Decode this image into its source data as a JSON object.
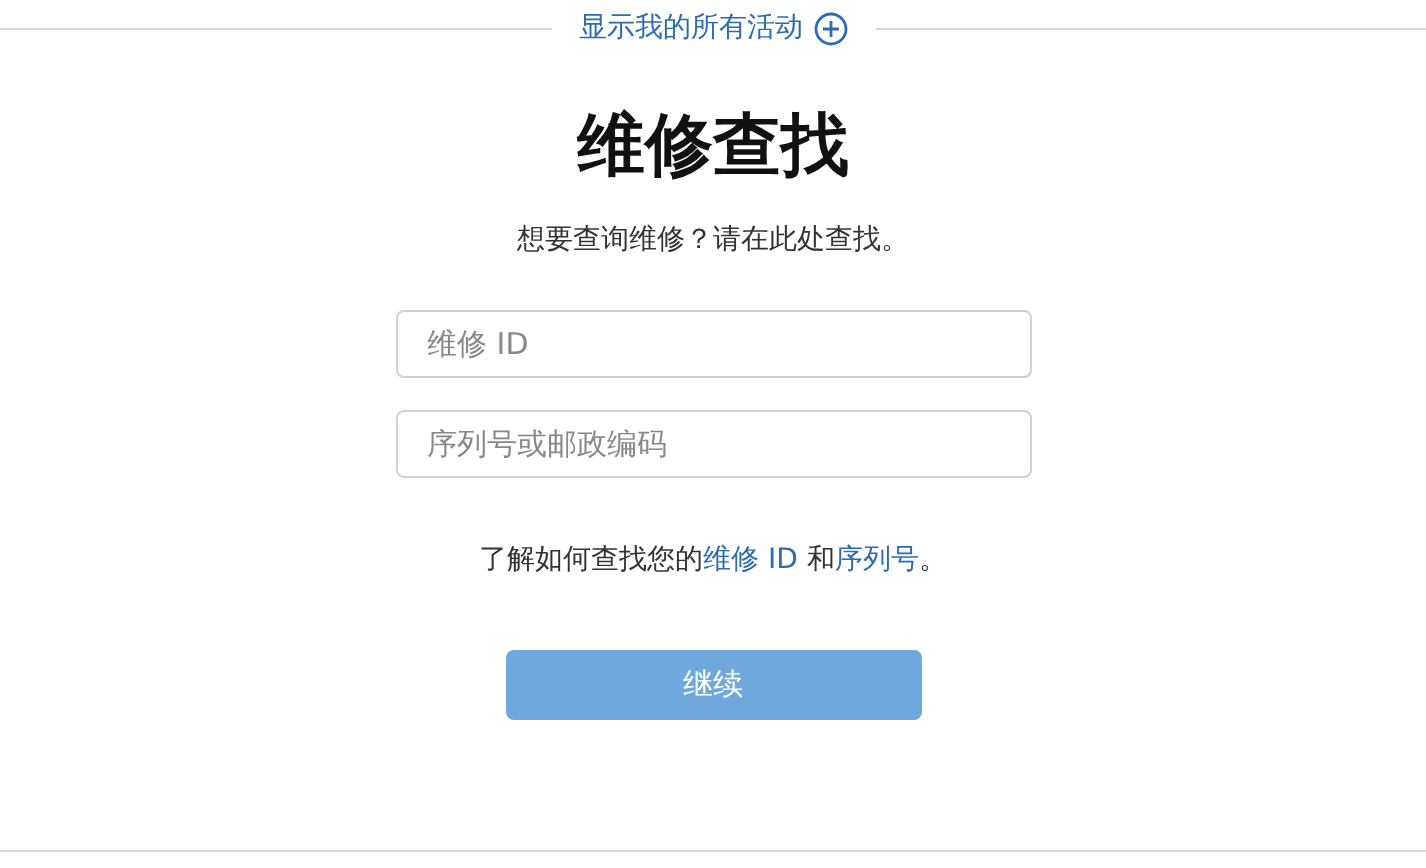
{
  "activity_link": {
    "label": "显示我的所有活动"
  },
  "title": "维修查找",
  "subtitle": "想要查询维修？请在此处查找。",
  "fields": [
    {
      "placeholder": "维修 ID"
    },
    {
      "placeholder": "序列号或邮政编码"
    }
  ],
  "help": {
    "parts": [
      {
        "kind": "text",
        "text": "了解如何查找您的"
      },
      {
        "kind": "link",
        "text": "维修 ID"
      },
      {
        "kind": "text",
        "text": " 和"
      },
      {
        "kind": "link",
        "text": "序列号"
      },
      {
        "kind": "text",
        "text": "。"
      }
    ]
  },
  "continue_button": {
    "label": "继续",
    "disabled": true
  }
}
